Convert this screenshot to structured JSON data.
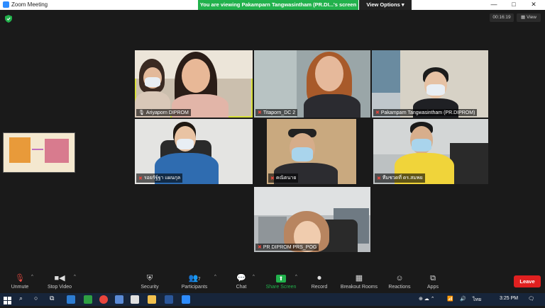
{
  "window": {
    "title": "Zoom Meeting"
  },
  "banner": {
    "text": "You are viewing Pakamparn Tangwasintham (PR.DI...'s screen",
    "view_options": "View Options"
  },
  "window_controls": {
    "minimize": "—",
    "maximize": "□",
    "close": "✕"
  },
  "top_right": {
    "timer": "00:16:19",
    "view": "View"
  },
  "participants": [
    {
      "name": "Ariyaporn DIPROM",
      "muted": false,
      "active": true
    },
    {
      "name": "Titaporn_DC 2",
      "muted": true,
      "active": false
    },
    {
      "name": "Pakamparn Tangwasintham (PR.DIPROM)",
      "muted": true,
      "active": false
    },
    {
      "name": "รอยรัฐ์ฐา แผนกุล",
      "muted": true,
      "active": false
    },
    {
      "name": "คณิตนาย",
      "muted": true,
      "active": false
    },
    {
      "name": "ทีมชวดที่ ดร.สมพย",
      "muted": true,
      "active": false
    },
    {
      "name": "PR DIPROM PRS_POG",
      "muted": true,
      "active": false
    }
  ],
  "toolbar": {
    "unmute": "Unmute",
    "stop_video": "Stop Video",
    "security": "Security",
    "participants": "Participants",
    "participants_count": "7",
    "chat": "Chat",
    "share_screen": "Share Screen",
    "record": "Record",
    "breakout_rooms": "Breakout Rooms",
    "reactions": "Reactions",
    "apps": "Apps",
    "leave": "Leave"
  },
  "taskbar": {
    "language": "ไทย",
    "time": "3:25 PM"
  },
  "colors": {
    "active_speaker": "#d8e03a",
    "share_green": "#22b14c",
    "leave_red": "#e02020"
  }
}
